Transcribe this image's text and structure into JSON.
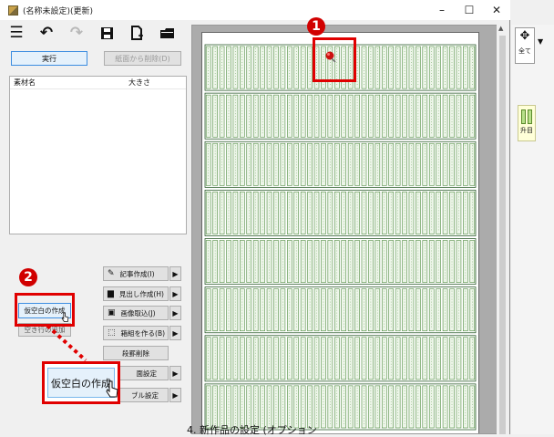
{
  "window": {
    "title": "(名称未設定)(更新)",
    "controls": [
      "–",
      "☐",
      "✕"
    ]
  },
  "toolbar": {
    "icons": [
      "menu-icon",
      "undo-icon",
      "redo-icon",
      "save-icon",
      "new-page-icon",
      "folder-icon"
    ]
  },
  "buttons": {
    "run": "実行",
    "remove_from_page": "紙面から削除(D)"
  },
  "material_list": {
    "col_name": "素材名",
    "col_size": "大きさ"
  },
  "left_actions": {
    "create_temp_space": "仮空白の作成",
    "blank_line_label": "空き行の追加"
  },
  "side_buttons": [
    {
      "icon": "✎",
      "label": "記事作成(I)"
    },
    {
      "icon": "▆",
      "label": "見出し作成(H)"
    },
    {
      "icon": "▣",
      "label": "画像取込(J)"
    },
    {
      "icon": "⬚",
      "label": "箱組を作る(B)"
    },
    {
      "icon": "",
      "label": "段罫削除"
    },
    {
      "icon": "",
      "label": "面設定"
    },
    {
      "icon": "",
      "label": "ブル設定"
    }
  ],
  "callouts": {
    "badge_1": "1",
    "badge_2": "2",
    "zoom_label": "仮空白の作成"
  },
  "right_panel": {
    "all_label": "全て",
    "column_label": "升目"
  },
  "background_text": "4. 新作品の設定 (オプション"
}
